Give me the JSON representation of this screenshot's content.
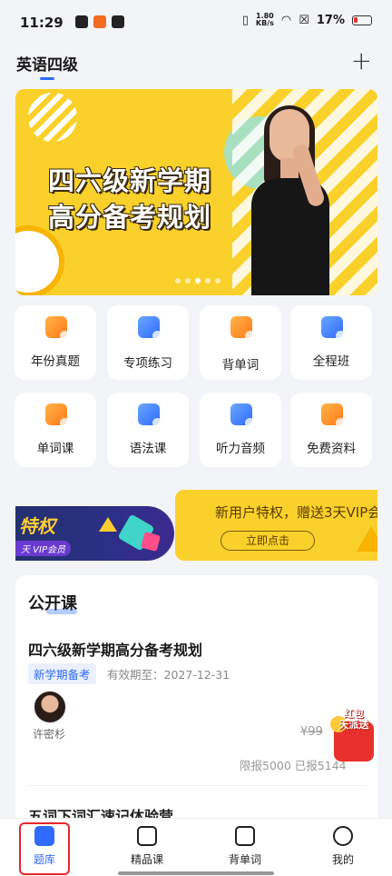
{
  "status_bar": {
    "time": "11:29",
    "net_speed_value": "1.80",
    "net_speed_unit": "KB/s",
    "battery": "17%"
  },
  "header": {
    "title": "英语四级",
    "add_label": "+"
  },
  "banner": {
    "line1": "四六级新学期",
    "line2": "高分备考规划",
    "dots": 5,
    "active_dot": 2
  },
  "features": [
    {
      "label": "年份真题",
      "color": "orange"
    },
    {
      "label": "专项练习",
      "color": "blue"
    },
    {
      "label": "背单词",
      "color": "orange"
    },
    {
      "label": "全程班",
      "color": "blue"
    },
    {
      "label": "单词课",
      "color": "orange"
    },
    {
      "label": "语法课",
      "color": "blue"
    },
    {
      "label": "听力音频",
      "color": "blue"
    },
    {
      "label": "免费资料",
      "color": "orange"
    }
  ],
  "promo": {
    "left_title": "特权",
    "left_sub": "天 VIP会员",
    "right_text": "新用户特权，赠送3天VIP会",
    "right_button": "立即点击"
  },
  "open_course": {
    "section_title": "公开课",
    "course_title": "四六级新学期高分备考规划",
    "tag": "新学期备考",
    "validity": "有效期至：2027-12-31",
    "teacher": "许密杉",
    "old_price": "¥99",
    "quota": "限报5000   已报5144",
    "next_title": "五词下词汇速记体验营"
  },
  "redpacket": {
    "line1": "红包",
    "line2": "天派送"
  },
  "nav": [
    {
      "label": "题库",
      "active": true
    },
    {
      "label": "精品课",
      "active": false
    },
    {
      "label": "背单词",
      "active": false
    },
    {
      "label": "我的",
      "active": false
    }
  ],
  "colors": {
    "accent": "#2f6bff",
    "banner_yellow": "#fad12a",
    "highlight_red": "#e8242c"
  }
}
